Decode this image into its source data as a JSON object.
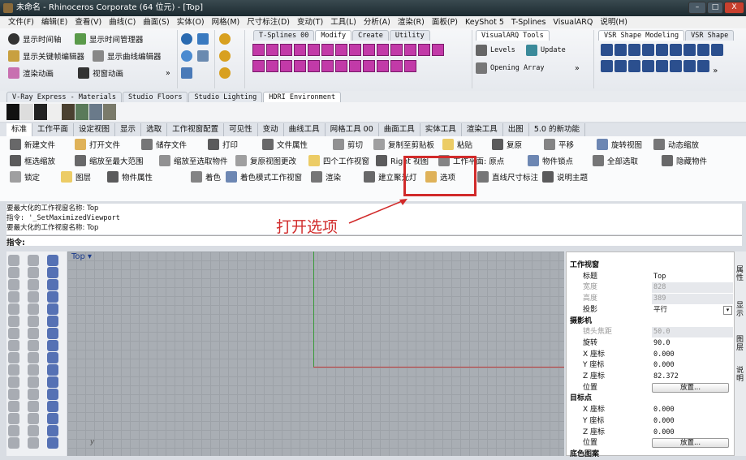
{
  "window": {
    "title": "未命名 - Rhinoceros Corporate (64 位元) - [Top]",
    "min": "–",
    "max": "□",
    "close": "X"
  },
  "menu": [
    "文件(F)",
    "编辑(E)",
    "查看(V)",
    "曲线(C)",
    "曲面(S)",
    "实体(O)",
    "网格(M)",
    "尺寸标注(D)",
    "变动(T)",
    "工具(L)",
    "分析(A)",
    "渲染(R)",
    "面板(P)",
    "KeyShot 5",
    "T-Splines",
    "VisualARQ",
    "说明(H)"
  ],
  "anim": {
    "items": [
      "显示时间轴",
      "显示时间管理器",
      "显示关键帧编辑器",
      "显示曲线编辑器",
      "渲染动画",
      "视窗动画"
    ],
    "more": "»"
  },
  "tsplines_tabs": [
    "T-Splines 00",
    "Modify",
    "Create",
    "Utility"
  ],
  "visualarq": {
    "tab": "VisualARQ Tools",
    "levels": "Levels",
    "update": "Update",
    "opening_array": "Opening Array",
    "more": "»"
  },
  "vsr": {
    "tabs": [
      "VSR Shape Modeling",
      "VSR Shape"
    ],
    "more": "»"
  },
  "plugin_tabs": [
    "V-Ray Express - Materials",
    "Studio Floors",
    "Studio Lighting",
    "HDRI Environment"
  ],
  "main_tabs": [
    "标准",
    "工作平面",
    "设定视图",
    "显示",
    "选取",
    "工作视窗配置",
    "可见性",
    "变动",
    "曲线工具",
    "网格工具 00",
    "曲面工具",
    "实体工具",
    "渲染工具",
    "出图",
    "5.0 的新功能"
  ],
  "cmd_rows": [
    [
      "新建文件",
      "打开文件",
      "储存文件",
      "打印",
      "文件属性",
      "剪切",
      "复制至剪贴板",
      "粘贴",
      "复原",
      "平移",
      "旋转视图",
      "动态缩放"
    ],
    [
      "框选缩放",
      "缩放至最大范围",
      "缩放至选取物件",
      "复原视图更改",
      "四个工作视窗",
      "Right 视图",
      "工作平面: 原点",
      "物件锁点",
      "全部选取",
      "隐藏物件"
    ],
    [
      "锁定",
      "图层",
      "物件属性",
      "着色",
      "着色模式工作视窗",
      "渲染",
      "建立聚光灯",
      "选项",
      "直线尺寸标注",
      "说明主题"
    ]
  ],
  "history": [
    "要最大化的工作视窗名称: Top",
    "指令: '_SetMaximizedViewport",
    "要最大化的工作视窗名称: Top"
  ],
  "command_prompt": "指令:",
  "viewport": {
    "name": "Top",
    "axis_label": "y"
  },
  "annotation": "打开选项",
  "properties": {
    "viewport_section": "工作视窗",
    "title_k": "标题",
    "title_v": "Top",
    "width_k": "宽度",
    "width_v": "828",
    "height_k": "高度",
    "height_v": "389",
    "proj_k": "投影",
    "proj_v": "平行",
    "camera_section": "摄影机",
    "lens_k": "镜头焦距",
    "lens_v": "50.0",
    "rot_k": "旋转",
    "rot_v": "90.0",
    "cx_k": "X 座标",
    "cx_v": "0.000",
    "cy_k": "Y 座标",
    "cy_v": "0.000",
    "cz_k": "Z 座标",
    "cz_v": "82.372",
    "pos_k": "位置",
    "place_btn": "放置...",
    "target_section": "目标点",
    "tx_k": "X 座标",
    "tx_v": "0.000",
    "ty_k": "Y 座标",
    "ty_v": "0.000",
    "tz_k": "Z 座标",
    "tz_v": "0.000",
    "tpos_k": "位置",
    "tplace_btn": "放置...",
    "bg_section": "底色图案"
  },
  "side_tabs": [
    "属性",
    "显示",
    "图层",
    "说明"
  ],
  "colors": {
    "accent_red": "#d12a2a",
    "tspline_magenta": "#c23aa8",
    "vsr_blue": "#2b4f8e"
  }
}
